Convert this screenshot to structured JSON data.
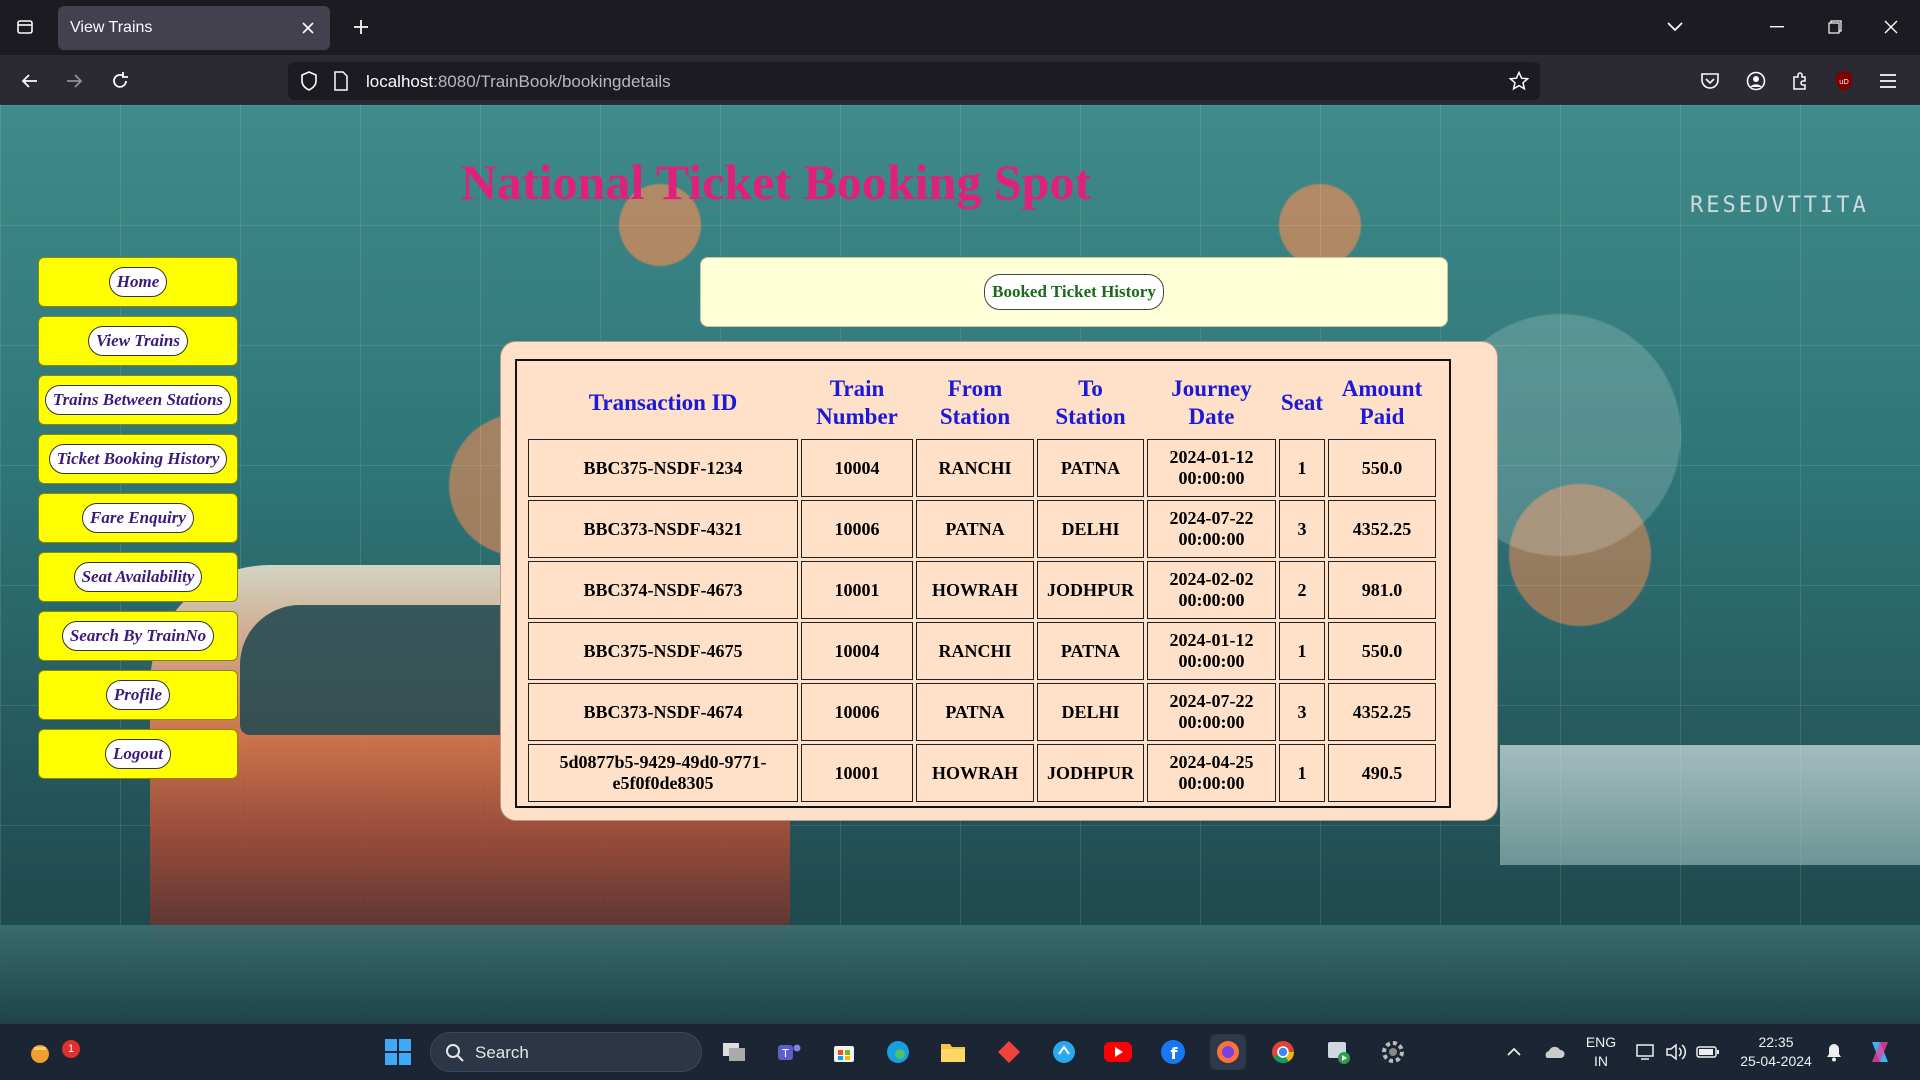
{
  "browser": {
    "tab_title": "View Trains",
    "url_host": "localhost",
    "url_rest": ":8080/TrainBook/bookingdetails"
  },
  "page": {
    "site_title": "National Ticket Booking Spot",
    "background_sign": "RESEDVTTITA",
    "menu": [
      {
        "label": "Home"
      },
      {
        "label": "View Trains"
      },
      {
        "label": "Trains Between Stations"
      },
      {
        "label": "Ticket Booking History"
      },
      {
        "label": "Fare Enquiry"
      },
      {
        "label": "Seat Availability"
      },
      {
        "label": "Search By TrainNo"
      },
      {
        "label": "Profile"
      },
      {
        "label": "Logout"
      }
    ],
    "header_button": "Booked Ticket History",
    "table": {
      "headers": {
        "transaction_id": "Transaction ID",
        "train_number_1": "Train",
        "train_number_2": "Number",
        "from_1": "From",
        "from_2": "Station",
        "to_1": "To",
        "to_2": "Station",
        "date_1": "Journey",
        "date_2": "Date",
        "seat": "Seat",
        "amount_1": "Amount",
        "amount_2": "Paid"
      },
      "rows": [
        {
          "txn": "BBC375-NSDF-1234",
          "train": "10004",
          "from": "RANCHI",
          "to": "PATNA",
          "date": "2024-01-12",
          "time": "00:00:00",
          "seat": "1",
          "amount": "550.0"
        },
        {
          "txn": "BBC373-NSDF-4321",
          "train": "10006",
          "from": "PATNA",
          "to": "DELHI",
          "date": "2024-07-22",
          "time": "00:00:00",
          "seat": "3",
          "amount": "4352.25"
        },
        {
          "txn": "BBC374-NSDF-4673",
          "train": "10001",
          "from": "HOWRAH",
          "to": "JODHPUR",
          "date": "2024-02-02",
          "time": "00:00:00",
          "seat": "2",
          "amount": "981.0"
        },
        {
          "txn": "BBC375-NSDF-4675",
          "train": "10004",
          "from": "RANCHI",
          "to": "PATNA",
          "date": "2024-01-12",
          "time": "00:00:00",
          "seat": "1",
          "amount": "550.0"
        },
        {
          "txn": "BBC373-NSDF-4674",
          "train": "10006",
          "from": "PATNA",
          "to": "DELHI",
          "date": "2024-07-22",
          "time": "00:00:00",
          "seat": "3",
          "amount": "4352.25"
        },
        {
          "txn": "5d0877b5-9429-49d0-9771-",
          "txn2": "e5f0f0de8305",
          "train": "10001",
          "from": "HOWRAH",
          "to": "JODHPUR",
          "date": "2024-04-25",
          "time": "00:00:00",
          "seat": "1",
          "amount": "490.5"
        }
      ]
    }
  },
  "taskbar": {
    "search_label": "Search",
    "notification_count": "1",
    "lang_1": "ENG",
    "lang_2": "IN",
    "time": "22:35",
    "date": "25-04-2024"
  },
  "colors": {
    "title": "#e0217c",
    "menu_bg": "#ffff00",
    "header_panel": "#ffffd8",
    "table_panel": "#ffe0c8",
    "table_header_text": "#1a1ad8"
  }
}
